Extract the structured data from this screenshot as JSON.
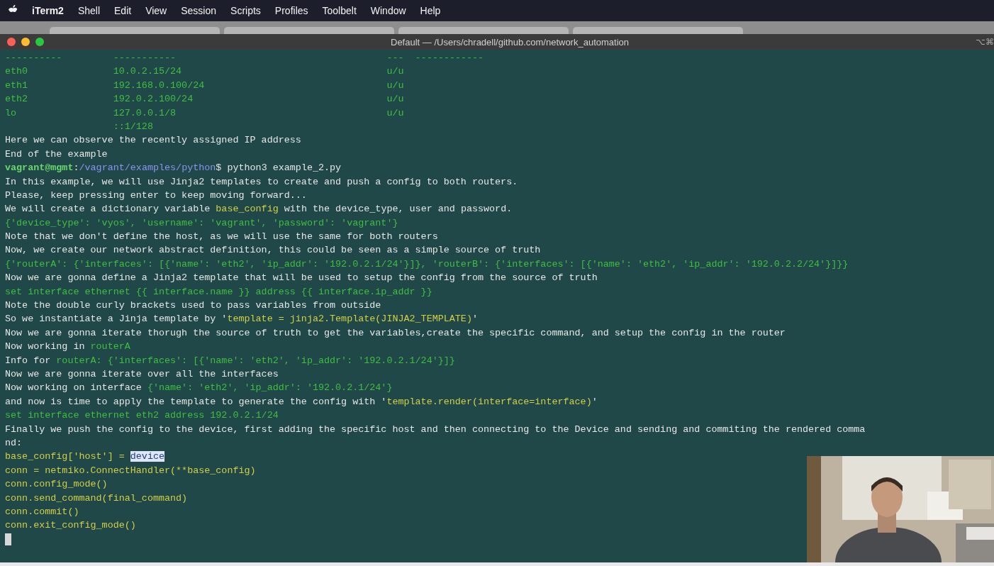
{
  "menu_bar": {
    "app": "iTerm2",
    "items": [
      "Shell",
      "Edit",
      "View",
      "Session",
      "Scripts",
      "Profiles",
      "Toolbelt",
      "Window",
      "Help"
    ]
  },
  "window": {
    "title": "Default — /Users/chradell/github.com/network_automation",
    "shortcut": "⌥⌘"
  },
  "terminal": {
    "lines": [
      [
        {
          "text": "----------         -----------                                     ---  ------------",
          "kind": "output"
        }
      ],
      [
        {
          "text": "eth0               10.0.2.15/24                                    u/u",
          "kind": "output"
        }
      ],
      [
        {
          "text": "eth1               192.168.0.100/24                                u/u",
          "kind": "output"
        }
      ],
      [
        {
          "text": "eth2               192.0.2.100/24                                  u/u",
          "kind": "output"
        }
      ],
      [
        {
          "text": "lo                 127.0.0.1/8                                     u/u",
          "kind": "output"
        }
      ],
      [
        {
          "text": "                   ::1/128",
          "kind": "output"
        }
      ],
      [
        {
          "text": "Here we can observe the recently assigned IP address",
          "kind": "plain"
        }
      ],
      [
        {
          "text": "End of the example",
          "kind": "plain"
        }
      ],
      [
        {
          "text": "vagrant@mgmt",
          "kind": "prompt"
        },
        {
          "text": ":",
          "kind": "plain"
        },
        {
          "text": "/vagrant/examples/python",
          "kind": "path"
        },
        {
          "text": "$ python3 example_2.py",
          "kind": "plain"
        }
      ],
      [
        {
          "text": "In this example, we will use Jinja2 templates to create and push a config to both routers.",
          "kind": "plain"
        }
      ],
      [
        {
          "text": "Please, keep pressing enter to keep moving forward...",
          "kind": "plain"
        }
      ],
      [
        {
          "text": "We will create a dictionary variable ",
          "kind": "plain"
        },
        {
          "text": "base_config",
          "kind": "code"
        },
        {
          "text": " with the device_type, user and password.",
          "kind": "plain"
        }
      ],
      [
        {
          "text": "{'device_type': 'vyos', 'username': 'vagrant', 'password': 'vagrant'}",
          "kind": "output"
        }
      ],
      [
        {
          "text": "Note that we don't define the host, as we will use the same for both routers",
          "kind": "plain"
        }
      ],
      [
        {
          "text": "Now, we create our network abstract definition, this could be seen as a simple source of truth",
          "kind": "plain"
        }
      ],
      [
        {
          "text": "{'routerA': {'interfaces': [{'name': 'eth2', 'ip_addr': '192.0.2.1/24'}]}, 'routerB': {'interfaces': [{'name': 'eth2', 'ip_addr': '192.0.2.2/24'}]}}",
          "kind": "output"
        }
      ],
      [
        {
          "text": "Now we are gonna define a Jinja2 template that will be used to setup the config from the source of truth",
          "kind": "plain"
        }
      ],
      [
        {
          "text": "set interface ethernet {{ interface.name }} address {{ interface.ip_addr }}",
          "kind": "output"
        }
      ],
      [
        {
          "text": "Note the double curly brackets used to pass variables from outside",
          "kind": "plain"
        }
      ],
      [
        {
          "text": "So we instantiate a Jinja template by '",
          "kind": "plain"
        },
        {
          "text": "template = jinja2.Template(JINJA2_TEMPLATE)",
          "kind": "code"
        },
        {
          "text": "'",
          "kind": "plain"
        }
      ],
      [
        {
          "text": "Now we are gonna iterate thorugh the source of truth to get the variables,create the specific command, and setup the config in the router",
          "kind": "plain"
        }
      ],
      [
        {
          "text": "Now working in ",
          "kind": "plain"
        },
        {
          "text": "routerA",
          "kind": "output"
        }
      ],
      [
        {
          "text": "Info for ",
          "kind": "plain"
        },
        {
          "text": "routerA: {'interfaces': [{'name': 'eth2', 'ip_addr': '192.0.2.1/24'}]}",
          "kind": "output"
        }
      ],
      [
        {
          "text": "Now we are gonna iterate over all the interfaces",
          "kind": "plain"
        }
      ],
      [
        {
          "text": "Now working on interface ",
          "kind": "plain"
        },
        {
          "text": "{'name': 'eth2', 'ip_addr': '192.0.2.1/24'}",
          "kind": "output"
        }
      ],
      [
        {
          "text": "and now is time to apply the template to generate the config with '",
          "kind": "plain"
        },
        {
          "text": "template.render(interface=interface)",
          "kind": "code"
        },
        {
          "text": "'",
          "kind": "plain"
        }
      ],
      [
        {
          "text": "set interface ethernet eth2 address 192.0.2.1/24",
          "kind": "output"
        }
      ],
      [
        {
          "text": "Finally we push the config to the device, first adding the specific host and then connecting to the Device and sending and commiting the rendered comma",
          "kind": "plain"
        }
      ],
      [
        {
          "text": "nd:",
          "kind": "plain"
        }
      ],
      [
        {
          "text": "base_config['host'] = ",
          "kind": "code"
        },
        {
          "text": "device",
          "kind": "selected"
        }
      ],
      [
        {
          "text": "conn = netmiko.ConnectHandler(**base_config)",
          "kind": "code"
        }
      ],
      [
        {
          "text": "conn.config_mode()",
          "kind": "code"
        }
      ],
      [
        {
          "text": "conn.send_command(final_command)",
          "kind": "code"
        }
      ],
      [
        {
          "text": "conn.commit()",
          "kind": "code"
        }
      ],
      [
        {
          "text": "conn.exit_config_mode()",
          "kind": "code"
        }
      ],
      [
        {
          "kind": "cursor"
        }
      ]
    ]
  }
}
